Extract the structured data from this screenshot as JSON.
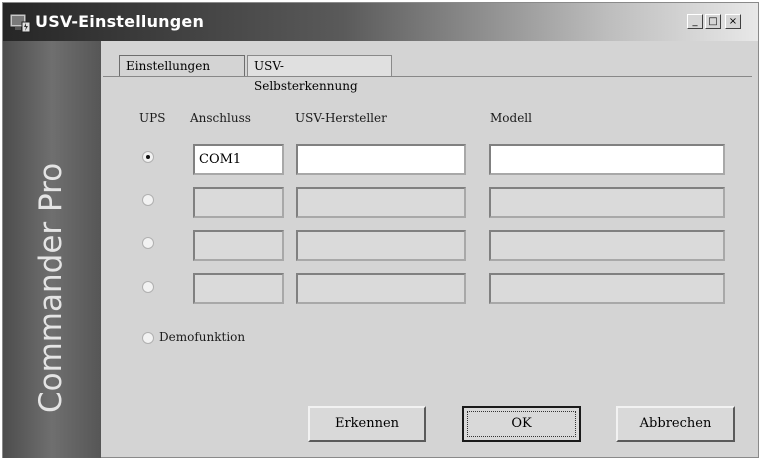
{
  "window": {
    "title": "USV-Einstellungen",
    "controls": {
      "minimize": "_",
      "maximize": "□",
      "close": "×"
    }
  },
  "sidebar": {
    "text": "Commander Pro"
  },
  "tabs": [
    {
      "label": "Einstellungen",
      "active": false
    },
    {
      "label": "USV-Selbsterkennung",
      "active": true
    }
  ],
  "table": {
    "headers": {
      "ups": "UPS",
      "port": "Anschluss",
      "manufacturer": "USV-Hersteller",
      "model": "Modell"
    },
    "rows": [
      {
        "selected": true,
        "port": "COM1",
        "manufacturer": "",
        "model": "",
        "enabled": true
      },
      {
        "selected": false,
        "port": "",
        "manufacturer": "",
        "model": "",
        "enabled": false
      },
      {
        "selected": false,
        "port": "",
        "manufacturer": "",
        "model": "",
        "enabled": false
      },
      {
        "selected": false,
        "port": "",
        "manufacturer": "",
        "model": "",
        "enabled": false
      }
    ]
  },
  "demo": {
    "label": "Demofunktion",
    "selected": false
  },
  "buttons": {
    "detect": "Erkennen",
    "ok": "OK",
    "cancel": "Abbrechen"
  }
}
